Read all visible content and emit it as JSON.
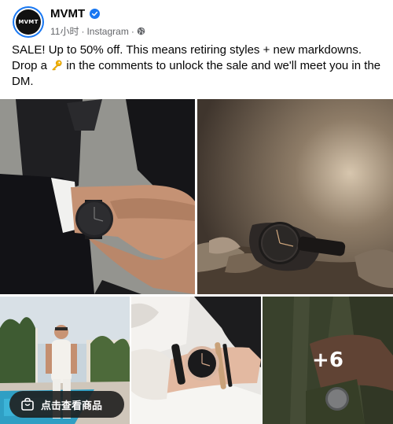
{
  "post": {
    "page_name": "MVMT",
    "avatar_text": "MVMT",
    "time": "11小时",
    "separator": "·",
    "source": "Instagram",
    "separator2": "·",
    "caption": "SALE! Up to 50% off. This means retiring styles + new markdowns. Drop a",
    "caption_after_emoji": "in the comments to unlock the sale and we'll meet you in the DM.",
    "emoji": "key-emoji",
    "more_photos_count": "+6",
    "shop_button_label": "点击查看商品"
  },
  "colors": {
    "verified_badge": "#1877f2",
    "meta_text": "#65676b",
    "text": "#050505"
  },
  "icons": {
    "verified": "verified-badge-icon",
    "audience": "globe-icon",
    "shop": "shopping-bag-icon"
  }
}
